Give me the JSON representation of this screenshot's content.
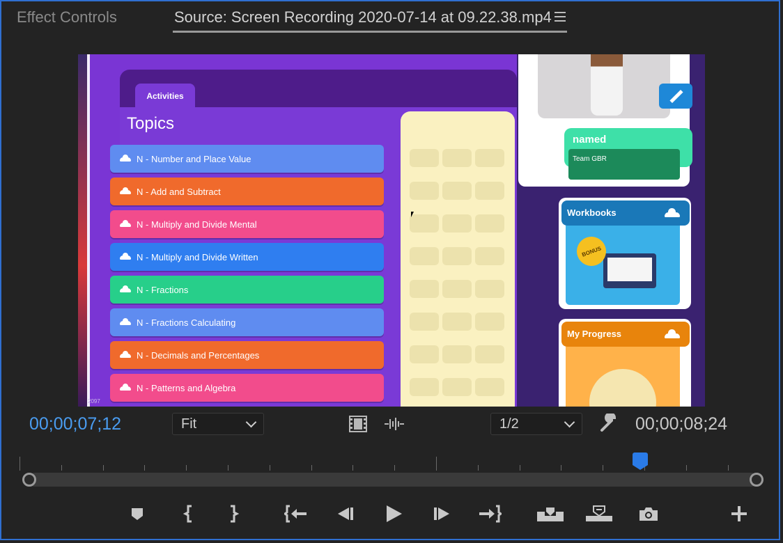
{
  "header": {
    "tab_effect_controls": "Effect Controls",
    "tab_source": "Source: Screen Recording 2020-07-14 at 09.22.38.mp4"
  },
  "video": {
    "activities_tab": "Activities",
    "topics_title": "Topics",
    "topics": [
      {
        "label": "N - Number and Place Value",
        "color": "#5f8cf0"
      },
      {
        "label": "N - Add and Subtract",
        "color": "#f06a2c"
      },
      {
        "label": "N - Multiply and Divide Mental",
        "color": "#f24c8c"
      },
      {
        "label": "N - Multiply and Divide Written",
        "color": "#2f7ef0"
      },
      {
        "label": "N - Fractions",
        "color": "#27cf8a"
      },
      {
        "label": "N - Fractions Calculating",
        "color": "#5f8cf0"
      },
      {
        "label": "N - Decimals and Percentages",
        "color": "#f06a2c"
      },
      {
        "label": "N - Patterns and Algebra",
        "color": "#f24c8c"
      }
    ],
    "named_label": "named",
    "team_label": "Team GBR",
    "workbooks_label": "Workbooks",
    "bonus_label": "BONUS",
    "my_progress_label": "My Progress",
    "watermark": "2097"
  },
  "controls": {
    "current_timecode": "00;00;07;12",
    "duration_timecode": "00;00;08;24",
    "zoom_value": "Fit",
    "resolution_value": "1/2",
    "playhead_position_fraction": 0.857,
    "accent_color": "#2a7be8"
  }
}
